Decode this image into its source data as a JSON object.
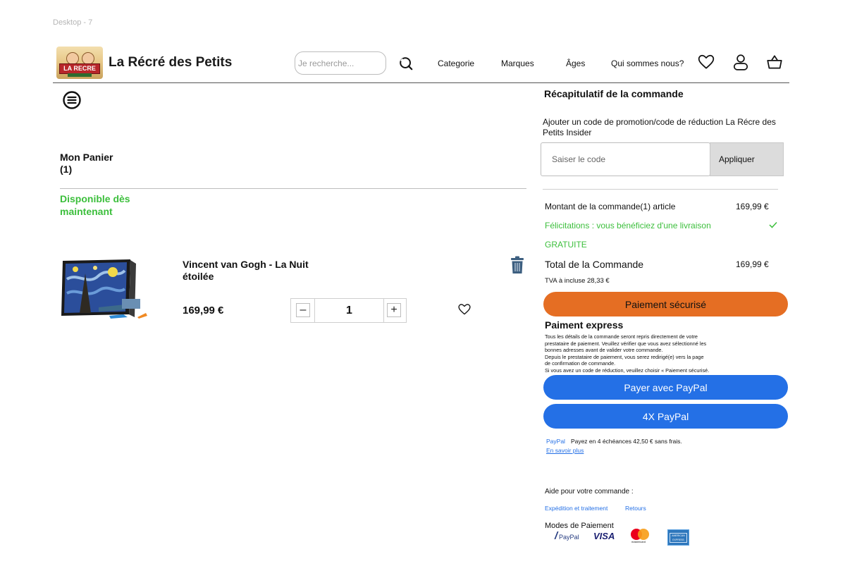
{
  "frame_label": "Desktop - 7",
  "header": {
    "logo_text": "LA RECRE",
    "brand": "La Récré des Petits",
    "search_placeholder": "Je recherche...",
    "nav": [
      "Categorie",
      "Marques",
      "Âges",
      "Qui sommes nous?"
    ],
    "icons": [
      "heart-icon",
      "user-icon",
      "basket-icon"
    ]
  },
  "cart": {
    "title_line1": "Mon Panier",
    "title_line2": "(1)",
    "availability": "Disponible dès maintenant",
    "item": {
      "name": "Vincent van Gogh - La Nuit étoilée",
      "price": "169,99 €",
      "quantity": "1",
      "minus": "–",
      "plus": "+"
    }
  },
  "summary": {
    "title": "Récapitulatif de la commande",
    "promo_label": "Ajouter un code de promotion/code de réduction La Récre des Petits Insider",
    "promo_placeholder": "Saiser le code",
    "apply": "Appliquer",
    "order_amount_label": "Montant de la commande(1) article",
    "order_amount_value": "169,99 €",
    "free_shipping_line1": "Félicitations : vous bénéficiez d'une livraison",
    "free_shipping_line2": "GRATUITE",
    "total_label": "Total de la Commande",
    "total_value": "169,99 €",
    "vat": "TVA à incluse 28,33 €",
    "secure_payment": "Paiement sécurisé",
    "express_title": "Paiment express",
    "express_lines": [
      "Tous les détails de la commande seront repris directement de votre",
      "prestataire de paiement. Veuillez vérifier que vous avez sélectionné les",
      " bonnes adresses avant de valider votre commande.",
      "Depuis le prestataire  de paiement, vous serez redirigé(e) vers la page",
      "de confirmation de  commande.",
      "Si vous avez un code de réduction, veuillez choisir « Paiement sécurisé."
    ],
    "paypal_button": "Payer avec PayPal",
    "paypal4x_button": "4X PayPal",
    "paypal_mini": "PayPal",
    "paypal_note": "Payez en 4 échéances 42,50 € sans frais.",
    "learn_more": "En savoir plus",
    "help_title": "Aide pour votre commande :",
    "help_links": [
      "Expédition et traitement",
      "Retours"
    ],
    "payment_modes_title": "Modes de Paiement",
    "payment_logos": [
      "PayPal",
      "VISA",
      "mastercard",
      "AMERICAN EXPRESS"
    ]
  },
  "colors": {
    "green": "#3cbf3c",
    "orange": "#e56e23",
    "paypal_blue": "#2470e6",
    "trash": "#3d5f80"
  }
}
